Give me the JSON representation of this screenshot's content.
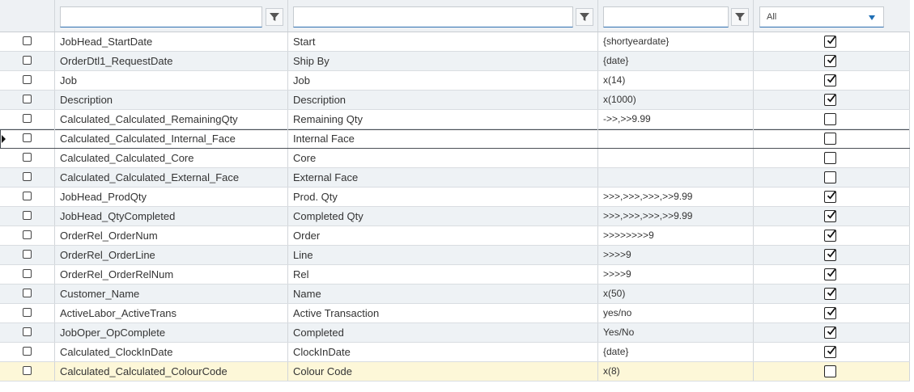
{
  "filters": {
    "col1_value": "",
    "col2_value": "",
    "col3_value": "",
    "col4_selected": "All"
  },
  "rows": [
    {
      "name": "JobHead_StartDate",
      "label": "Start",
      "format": "{shortyeardate}",
      "visible": true
    },
    {
      "name": "OrderDtl1_RequestDate",
      "label": "Ship By",
      "format": "{date}",
      "visible": true
    },
    {
      "name": "Job",
      "label": "Job",
      "format": "x(14)",
      "visible": true
    },
    {
      "name": "Description",
      "label": "Description",
      "format": "x(1000)",
      "visible": true
    },
    {
      "name": "Calculated_Calculated_RemainingQty",
      "label": "Remaining Qty",
      "format": "->>,>>9.99",
      "visible": false
    },
    {
      "name": "Calculated_Calculated_Internal_Face",
      "label": "Internal Face",
      "format": "",
      "visible": false
    },
    {
      "name": "Calculated_Calculated_Core",
      "label": "Core",
      "format": "",
      "visible": false
    },
    {
      "name": "Calculated_Calculated_External_Face",
      "label": "External Face",
      "format": "",
      "visible": false
    },
    {
      "name": "JobHead_ProdQty",
      "label": "Prod. Qty",
      "format": ">>>,>>>,>>>,>>9.99",
      "visible": true
    },
    {
      "name": "JobHead_QtyCompleted",
      "label": "Completed Qty",
      "format": ">>>,>>>,>>>,>>9.99",
      "visible": true
    },
    {
      "name": "OrderRel_OrderNum",
      "label": "Order",
      "format": ">>>>>>>>9",
      "visible": true
    },
    {
      "name": "OrderRel_OrderLine",
      "label": "Line",
      "format": ">>>>9",
      "visible": true
    },
    {
      "name": "OrderRel_OrderRelNum",
      "label": "Rel",
      "format": ">>>>9",
      "visible": true
    },
    {
      "name": "Customer_Name",
      "label": "Name",
      "format": "x(50)",
      "visible": true
    },
    {
      "name": "ActiveLabor_ActiveTrans",
      "label": "Active Transaction",
      "format": "yes/no",
      "visible": true
    },
    {
      "name": "JobOper_OpComplete",
      "label": "Completed",
      "format": "Yes/No",
      "visible": true
    },
    {
      "name": "Calculated_ClockInDate",
      "label": "ClockInDate",
      "format": "{date}",
      "visible": true
    },
    {
      "name": "Calculated_Calculated_ColourCode",
      "label": "Colour Code",
      "format": "x(8)",
      "visible": false
    }
  ],
  "current_row": 5,
  "highlight_row": 17,
  "icons": {
    "filter": "filter-funnel-icon",
    "dropdown": "chevron-down-icon",
    "check": "checkmark-icon"
  }
}
